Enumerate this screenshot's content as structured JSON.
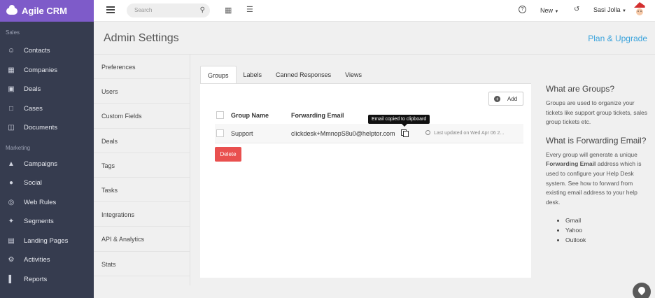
{
  "brand": {
    "name": "Agile CRM"
  },
  "sidebar": {
    "sections": [
      {
        "label": "Sales",
        "items": [
          {
            "label": "Contacts",
            "icon": "user-icon"
          },
          {
            "label": "Companies",
            "icon": "building-icon"
          },
          {
            "label": "Deals",
            "icon": "money-icon"
          },
          {
            "label": "Cases",
            "icon": "folder-icon"
          },
          {
            "label": "Documents",
            "icon": "document-icon"
          }
        ]
      },
      {
        "label": "Marketing",
        "items": [
          {
            "label": "Campaigns",
            "icon": "sitemap-icon"
          },
          {
            "label": "Social",
            "icon": "chat-icon"
          },
          {
            "label": "Web Rules",
            "icon": "globe-icon"
          },
          {
            "label": "Segments",
            "icon": "crosshair-icon"
          },
          {
            "label": "Landing Pages",
            "icon": "page-icon"
          },
          {
            "label": "Activities",
            "icon": "cogs-icon"
          },
          {
            "label": "Reports",
            "icon": "bar-chart-icon"
          }
        ]
      }
    ]
  },
  "topbar": {
    "search_placeholder": "Search",
    "new_label": "New",
    "user_name": "Sasi Jolla"
  },
  "header": {
    "title": "Admin Settings",
    "plan_link": "Plan & Upgrade"
  },
  "settings_nav": [
    "Preferences",
    "Users",
    "Custom Fields",
    "Deals",
    "Tags",
    "Tasks",
    "Integrations",
    "API & Analytics",
    "Stats"
  ],
  "tabs": [
    {
      "label": "Groups",
      "active": true
    },
    {
      "label": "Labels",
      "active": false
    },
    {
      "label": "Canned Responses",
      "active": false
    },
    {
      "label": "Views",
      "active": false
    }
  ],
  "groups": {
    "add_label": "Add",
    "columns": [
      "Group Name",
      "Forwarding Email"
    ],
    "rows": [
      {
        "name": "Support",
        "email": "clickdesk+MmnopS8u0@helptor.com",
        "updated": "Last updated on  Wed Apr 06 2..."
      }
    ],
    "tooltip": "Email copied to clipboard",
    "delete_label": "Delete"
  },
  "help": {
    "groups_title": "What are Groups?",
    "groups_text": "Groups are used to organize your tickets like support group tickets, sales group tickets etc.",
    "forwarding_title": "What is Forwarding Email?",
    "forwarding_text_1": "Every group will generate a unique ",
    "forwarding_text_bold": "Forwarding Email",
    "forwarding_text_2": " address which is used to configure your Help Desk system. See how to forward from existing email address to your help desk.",
    "providers": [
      "Gmail",
      "Yahoo",
      "Outlook"
    ]
  }
}
